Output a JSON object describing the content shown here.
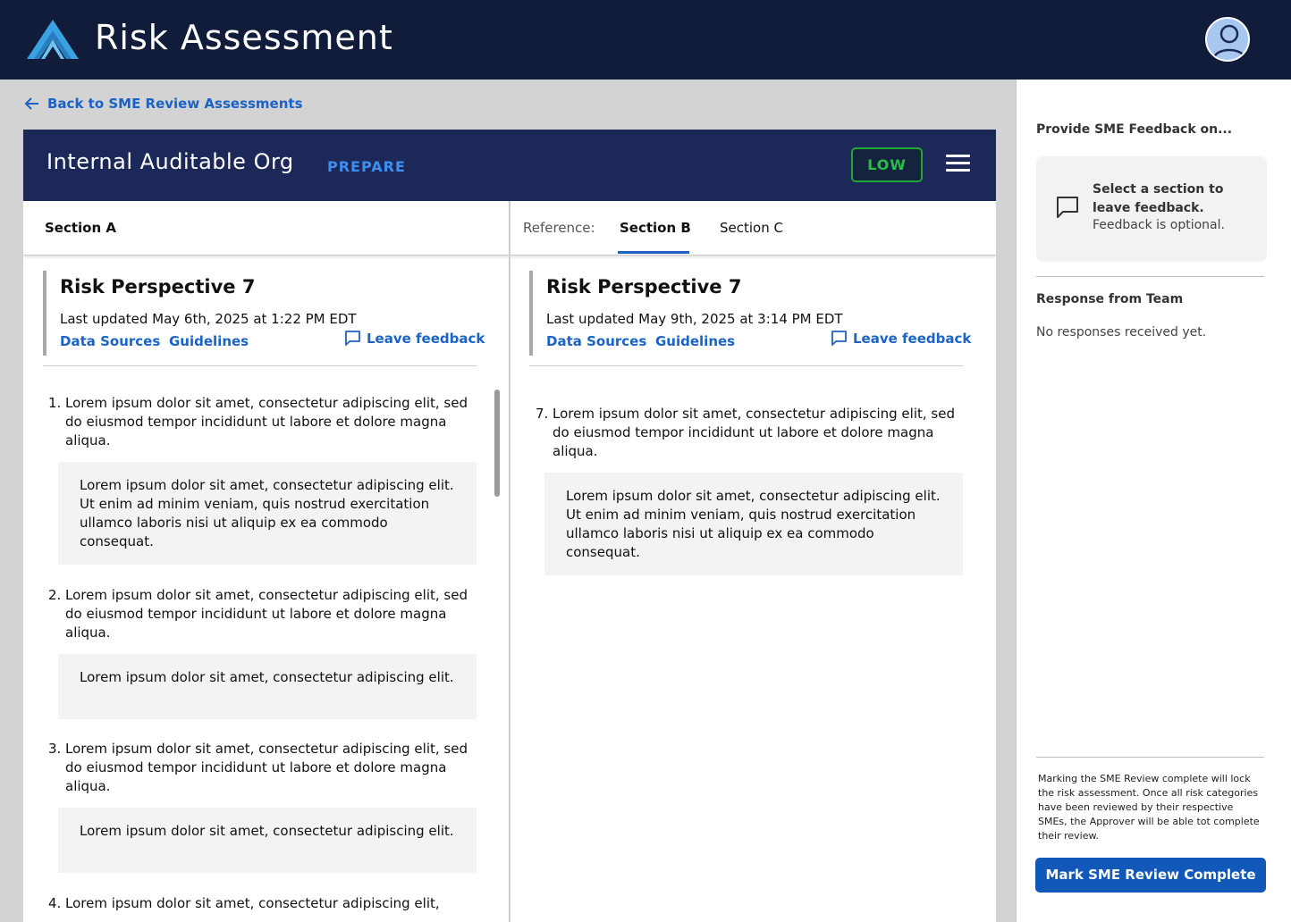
{
  "app": {
    "title": "Risk Assessment"
  },
  "nav": {
    "back_label": "Back to SME Review Assessments"
  },
  "org": {
    "name": "Internal Auditable Org",
    "stage": "PREPARE",
    "risk_level": "LOW"
  },
  "left_panel": {
    "tab_label": "Section A",
    "perspective": {
      "title": "Risk Perspective 7",
      "updated": "Last updated May 6th, 2025 at 1:22 PM EDT",
      "data_sources": "Data Sources",
      "guidelines": "Guidelines",
      "feedback": "Leave feedback"
    },
    "items": [
      {
        "num": "1.",
        "text": "Lorem ipsum dolor sit amet, consectetur adipiscing elit, sed do eiusmod tempor incididunt ut labore et dolore magna aliqua.",
        "response": "Lorem ipsum dolor sit amet, consectetur adipiscing elit. Ut enim ad minim veniam, quis nostrud exercitation ullamco laboris nisi ut aliquip ex ea commodo consequat."
      },
      {
        "num": "2.",
        "text": "Lorem ipsum dolor sit amet, consectetur adipiscing elit, sed do eiusmod tempor incididunt ut labore et dolore magna aliqua.",
        "response": "Lorem ipsum dolor sit amet, consectetur adipiscing elit."
      },
      {
        "num": "3.",
        "text": "Lorem ipsum dolor sit amet, consectetur adipiscing elit, sed do eiusmod tempor incididunt ut labore et dolore magna aliqua.",
        "response": "Lorem ipsum dolor sit amet, consectetur adipiscing elit."
      },
      {
        "num": "4.",
        "text": "Lorem ipsum dolor sit amet, consectetur adipiscing elit,"
      }
    ]
  },
  "right_panel": {
    "reference_label": "Reference:",
    "tabs": [
      {
        "label": "Section B",
        "active": true
      },
      {
        "label": "Section C",
        "active": false
      }
    ],
    "perspective": {
      "title": "Risk Perspective 7",
      "updated": "Last updated May 9th, 2025 at 3:14 PM EDT",
      "data_sources": "Data Sources",
      "guidelines": "Guidelines",
      "feedback": "Leave feedback"
    },
    "items": [
      {
        "num": "7.",
        "text": "Lorem ipsum dolor sit amet, consectetur adipiscing elit, sed do eiusmod tempor incididunt ut labore et dolore magna aliqua.",
        "response": "Lorem ipsum dolor sit amet, consectetur adipiscing elit. Ut enim ad minim veniam, quis nostrud exercitation ullamco laboris nisi ut aliquip ex ea commodo consequat."
      }
    ]
  },
  "sidebar": {
    "title": "Provide SME Feedback on...",
    "card_bold": "Select a section to leave feedback.",
    "card_note": "Feedback is optional.",
    "response_title": "Response from Team",
    "response_empty": "No responses received yet.",
    "note": "Marking the SME Review complete will lock the risk assessment. Once all risk categories have been reviewed by their respective SMEs, the Approver will be able tot complete their review.",
    "complete_button": "Mark SME Review Complete"
  },
  "colors": {
    "topbar": "#111b3a",
    "header": "#1c2958",
    "link": "#1b63c6",
    "stage": "#3d8ef0",
    "risk_low": "#2bbd48",
    "button": "#1258b8"
  },
  "icons": [
    "logo-icon",
    "user-avatar-icon",
    "arrow-left-icon",
    "menu-icon",
    "comment-icon"
  ]
}
